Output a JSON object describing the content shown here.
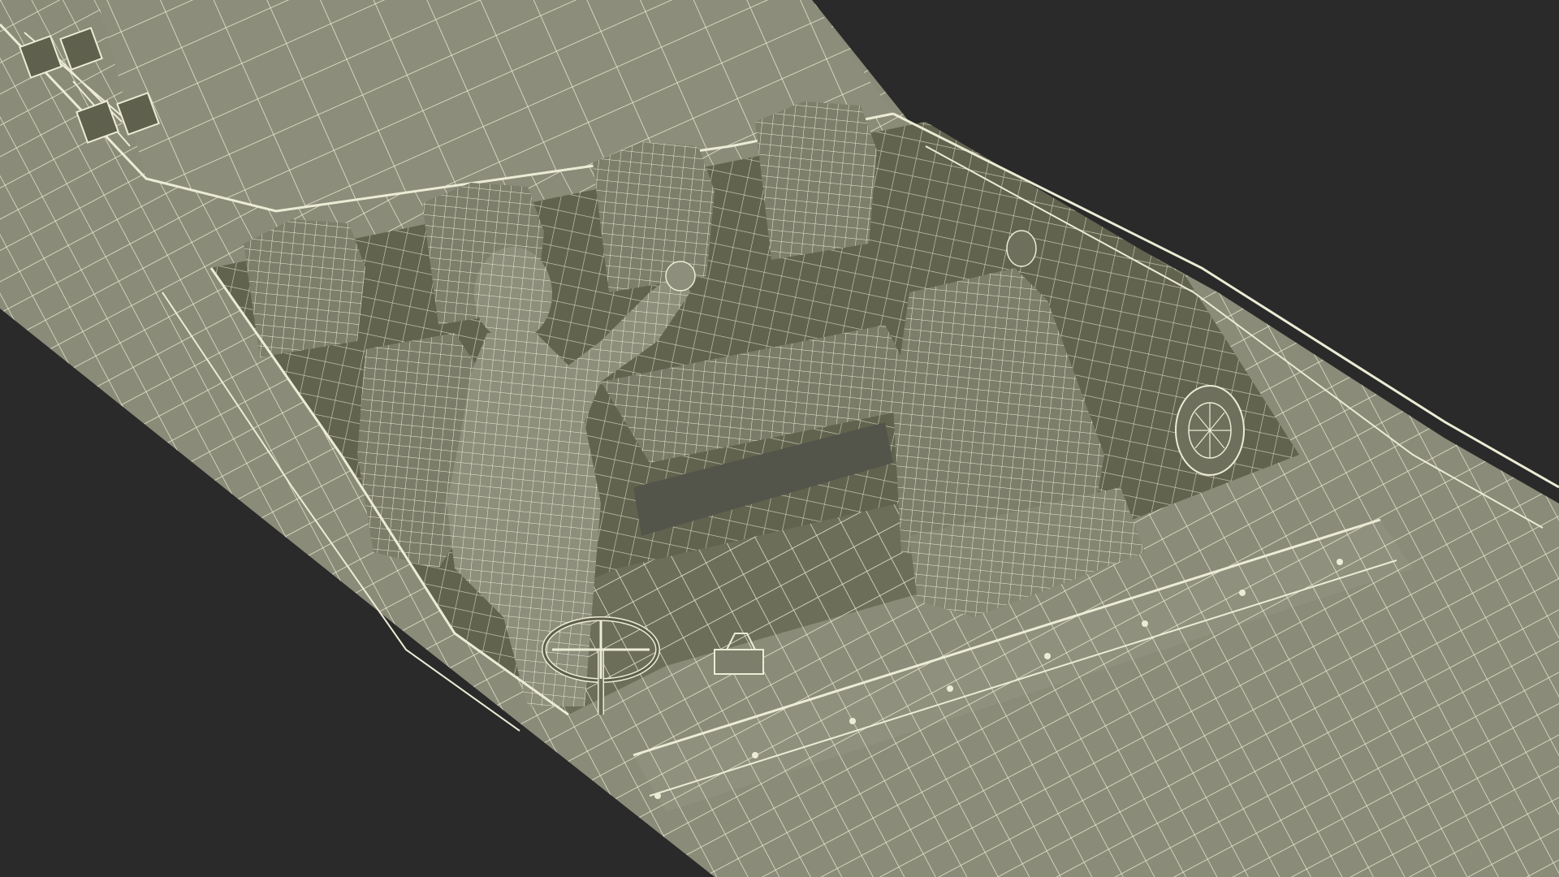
{
  "scene": {
    "background_color": "#2a2a2a",
    "mesh_fill_color": "#8a8b78",
    "mesh_shadow_color": "#62634f",
    "mesh_dark_color": "#4f5042",
    "wire_color": "#ececd6",
    "render_style": "wireframe-over-shaded",
    "subject": "speedboat-with-driver"
  }
}
